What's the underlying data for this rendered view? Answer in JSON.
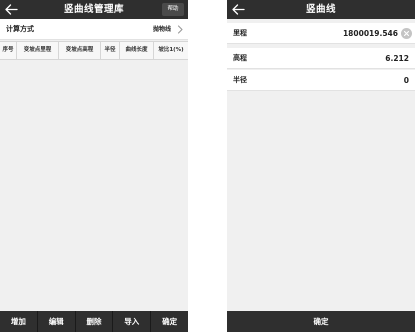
{
  "left_screen": {
    "header": {
      "title": "竖曲线管理库",
      "help_label": "帮助"
    },
    "calc_method": {
      "label": "计算方式",
      "value": "抛物线"
    },
    "table": {
      "columns": [
        "序号",
        "变坡点里程",
        "变坡点高程",
        "半径",
        "曲线长度",
        "坡比1(%)"
      ],
      "rows": []
    },
    "bottom_bar": {
      "add_label": "增加",
      "edit_label": "编辑",
      "delete_label": "删除",
      "import_label": "导入",
      "confirm_label": "确定"
    }
  },
  "right_screen": {
    "header": {
      "title": "竖曲线"
    },
    "fields": {
      "mileage": {
        "label": "里程",
        "value": "1800019.546"
      },
      "elevation": {
        "label": "高程",
        "value": "6.212"
      },
      "radius": {
        "label": "半径",
        "value": "0"
      }
    },
    "confirm_label": "确定"
  },
  "icons": {
    "back": "back-arrow-icon",
    "chevron": "chevron-right-icon",
    "clear": "clear-circle-icon"
  },
  "colors": {
    "bar_background": "#2f2f2f",
    "screen_background": "#f0f0f0",
    "row_background": "#ffffff"
  }
}
